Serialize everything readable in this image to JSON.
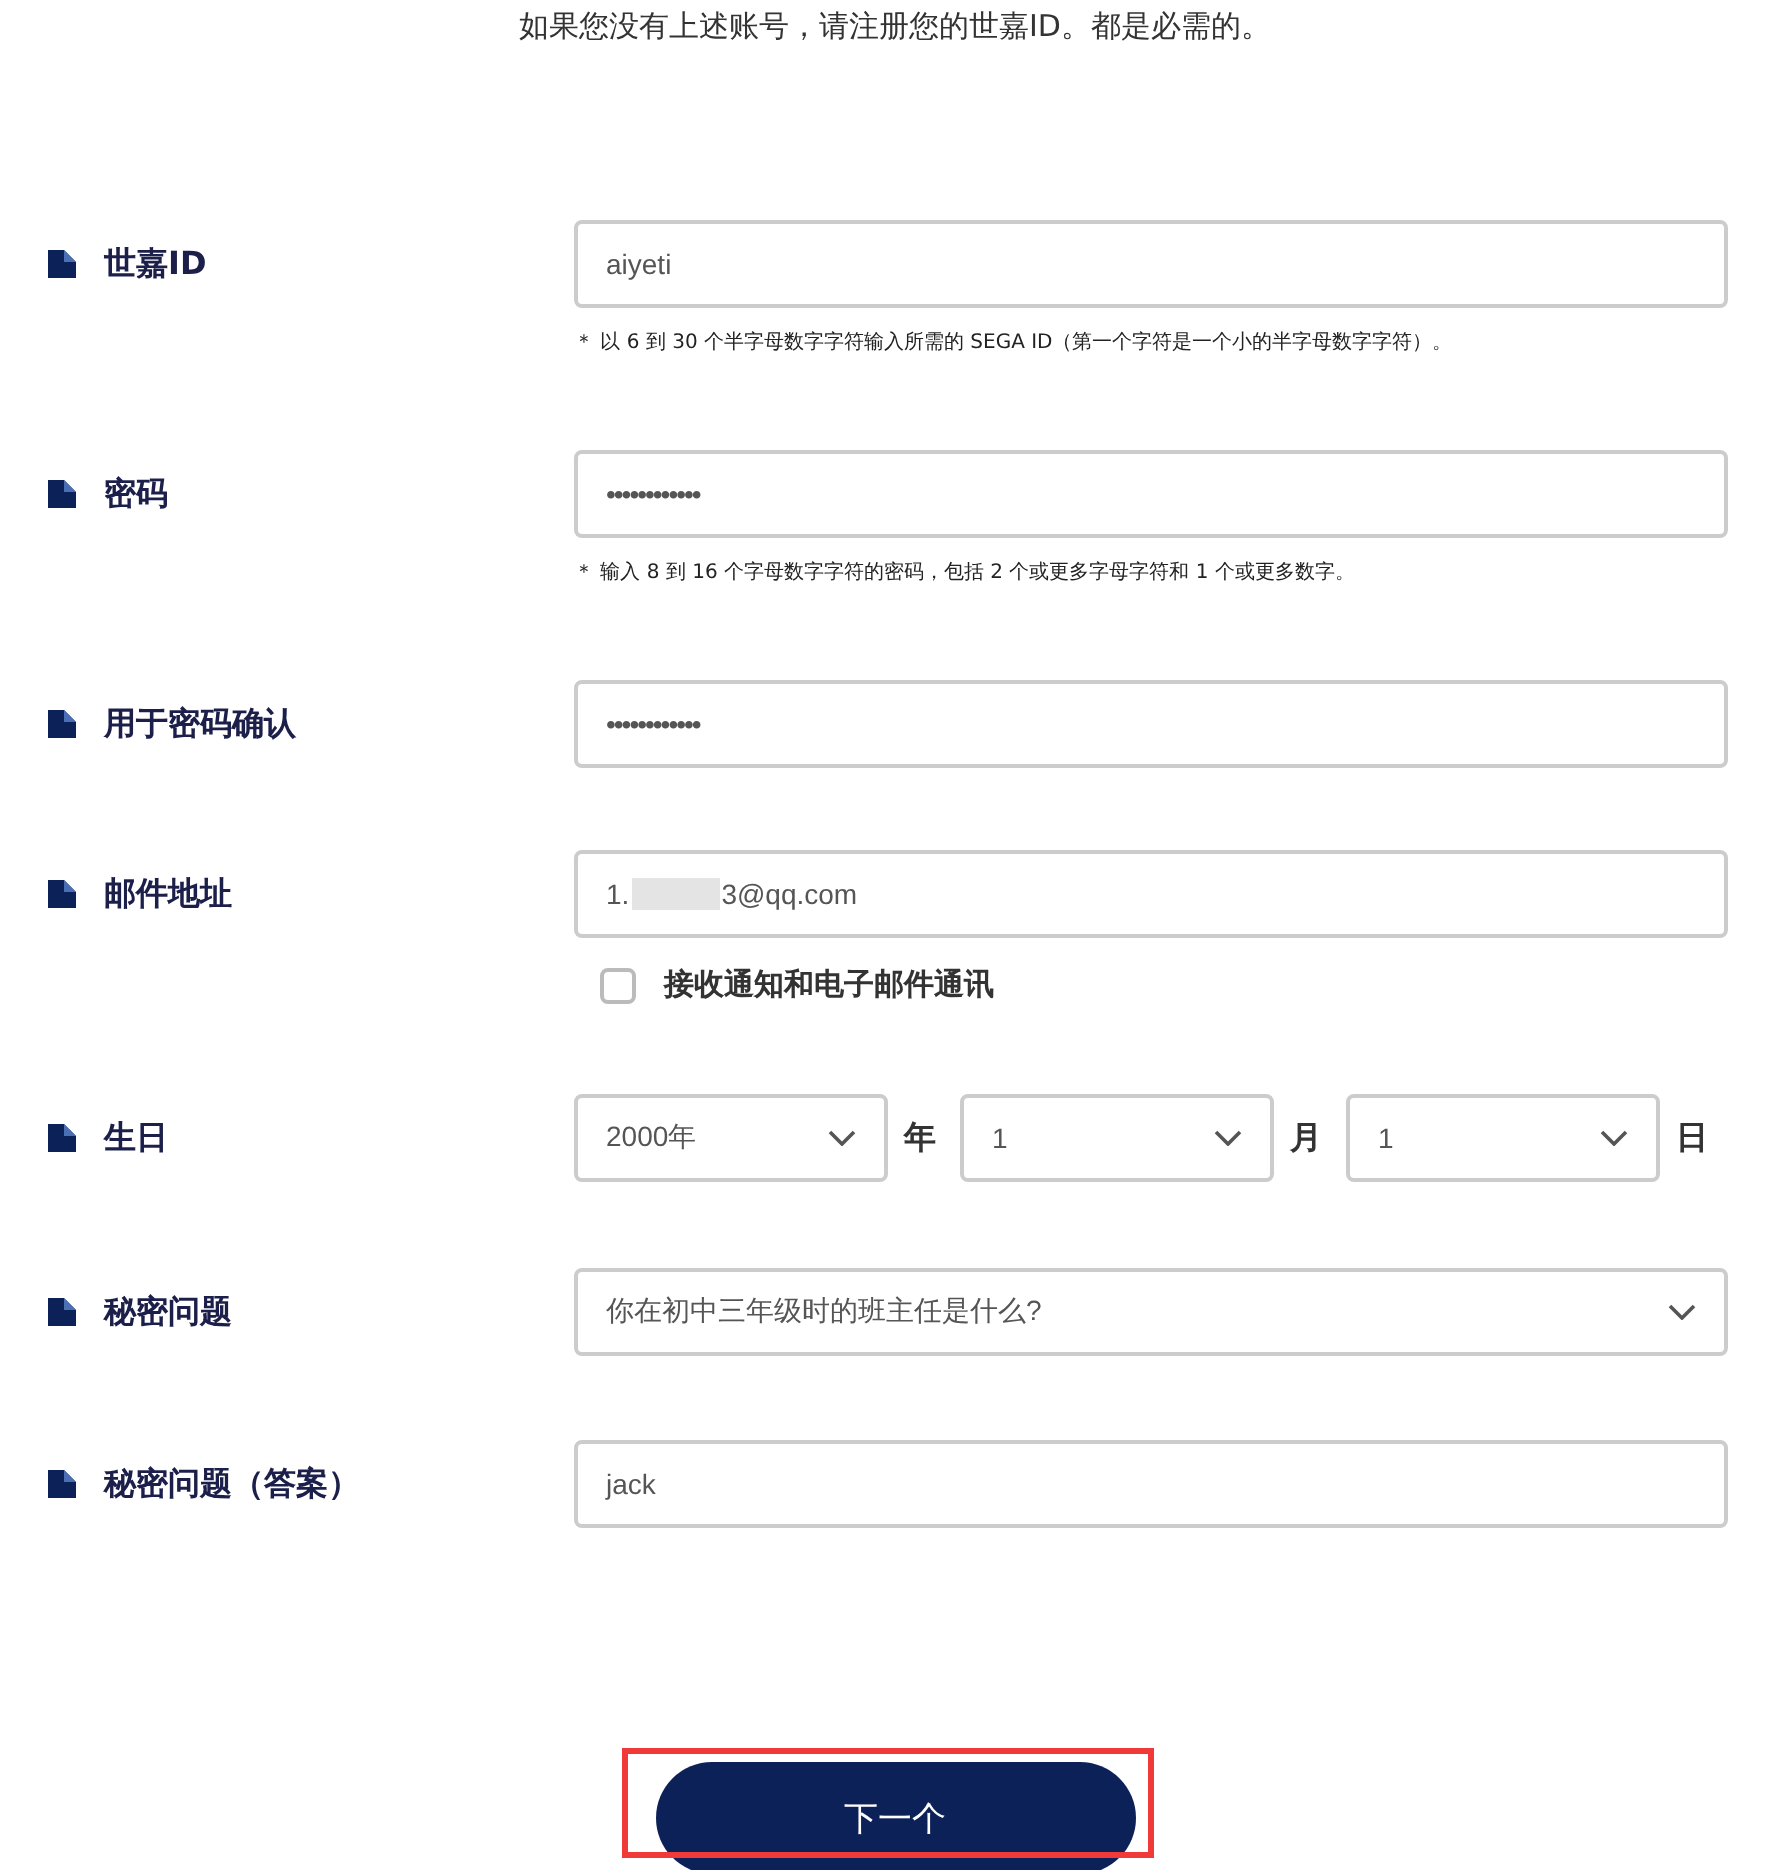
{
  "intro": "如果您没有上述账号，请注册您的世嘉ID。都是必需的。",
  "fields": [
    {
      "kind": "text",
      "label": "世嘉ID",
      "value": "aiyeti",
      "hint": "＊ 以 6 到 30 个半字母数字字符输入所需的 SEGA ID（第一个字符是一个小的半字母数字字符）。"
    },
    {
      "kind": "password",
      "label": "密码",
      "value": "••••••••••••",
      "hint": "＊ 输入 8 到 16 个字母数字字符的密码，包括 2 个或更多字母字符和 1 个或更多数字。"
    },
    {
      "kind": "password",
      "label": "用于密码确认",
      "value": "••••••••••••"
    },
    {
      "kind": "email",
      "label": "邮件地址",
      "value_start": "1.",
      "value_end": "3@qq.com",
      "checkbox": {
        "label": "接收通知和电子邮件通讯",
        "checked": false
      }
    },
    {
      "kind": "date",
      "label": "生日",
      "parts": [
        {
          "value": "2000年",
          "unit": "年"
        },
        {
          "value": "1",
          "unit": "月"
        },
        {
          "value": "1",
          "unit": "日"
        }
      ]
    },
    {
      "kind": "select",
      "label": "秘密问题",
      "value": "你在初中三年级时的班主任是什么?"
    },
    {
      "kind": "text",
      "label": "秘密问题（答案）",
      "value": "jack"
    }
  ],
  "next_button": {
    "label": "下一个",
    "highlighted": true
  }
}
